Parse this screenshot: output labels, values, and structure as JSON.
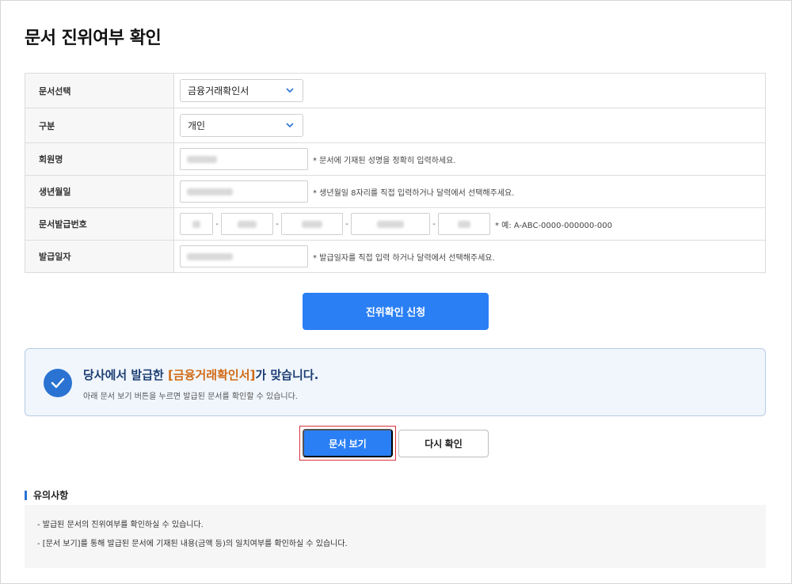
{
  "page": {
    "title": "문서 진위여부 확인"
  },
  "form": {
    "doc_select": {
      "label": "문서선택",
      "value": "금융거래확인서"
    },
    "category": {
      "label": "구분",
      "value": "개인"
    },
    "member_name": {
      "label": "회원명",
      "hint": "* 문서에 기재된 성명을 정확히 입력하세요."
    },
    "birth_date": {
      "label": "생년월일",
      "hint": "* 생년월일 8자리를 직접 입력하거나 달력에서 선택해주세요."
    },
    "doc_number": {
      "label": "문서발급번호",
      "hint": "* 예: A-ABC-0000-000000-000",
      "separator": "-"
    },
    "issue_date": {
      "label": "발급일자",
      "hint": "* 발급일자를 직접 입력 하거나 달력에서 선택해주세요."
    }
  },
  "actions": {
    "apply_label": "진위확인 신청"
  },
  "result": {
    "prefix": "당사에서 발급한 ",
    "highlight": "[금융거래확인서]",
    "suffix": "가 맞습니다.",
    "sub": "아래 문서 보기 버튼을 누르면 발급된 문서를 확인할 수 있습니다."
  },
  "buttons": {
    "view_label": "문서 보기",
    "recheck_label": "다시 확인"
  },
  "notes": {
    "title": "유의사항",
    "items": [
      "- 발급된 문서의 진위여부를 확인하실 수 있습니다.",
      "- [문서 보기]를 통해 발급된 문서에 기재된 내용(금액 등)의 일치여부를 확인하실 수 있습니다."
    ]
  },
  "icons": {
    "chevron": "chevron-down-icon",
    "check": "check-icon"
  },
  "colors": {
    "primary": "#2a7ff5",
    "highlight": "#d06a14",
    "heading": "#1d3e73",
    "focus_outline": "#d9323a"
  }
}
